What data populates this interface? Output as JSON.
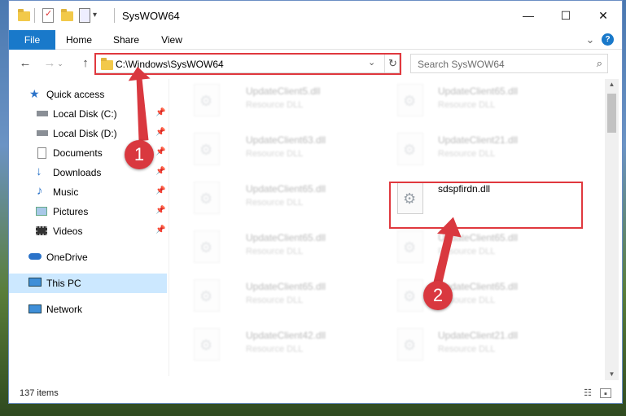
{
  "window": {
    "title": "SysWOW64",
    "controls": {
      "minimize": "—",
      "maximize": "☐",
      "close": "✕"
    }
  },
  "quick_access_toolbar": {
    "dropdown": "▾"
  },
  "ribbon": {
    "tabs": [
      "File",
      "Home",
      "Share",
      "View"
    ],
    "collapse": "⌄",
    "help": "?"
  },
  "nav": {
    "back": "←",
    "forward": "→",
    "up": "↑",
    "address": "C:\\Windows\\SysWOW64",
    "address_dropdown": "⌄",
    "refresh": "↻",
    "search_placeholder": "Search SysWOW64",
    "search_icon": "⌕"
  },
  "sidebar": {
    "quick_access": "Quick access",
    "items": [
      {
        "label": "Local Disk (C:)",
        "icon": "drive-icon",
        "pinned": true
      },
      {
        "label": "Local Disk (D:)",
        "icon": "drive-icon",
        "pinned": true
      },
      {
        "label": "Documents",
        "icon": "documents-icon",
        "pinned": true
      },
      {
        "label": "Downloads",
        "icon": "downloads-icon",
        "pinned": true
      },
      {
        "label": "Music",
        "icon": "music-icon",
        "pinned": true
      },
      {
        "label": "Pictures",
        "icon": "pictures-icon",
        "pinned": true
      },
      {
        "label": "Videos",
        "icon": "videos-icon",
        "pinned": true
      }
    ],
    "onedrive": "OneDrive",
    "this_pc": "This PC",
    "network": "Network",
    "pin_glyph": "📌"
  },
  "files": {
    "left": [
      {
        "name": "UpdateClient5.dll",
        "type": "Resource DLL"
      },
      {
        "name": "UpdateClient63.dll",
        "type": "Resource DLL"
      },
      {
        "name": "UpdateClient65.dll",
        "type": "Resource DLL"
      },
      {
        "name": "UpdateClient65.dll",
        "type": "Resource DLL"
      },
      {
        "name": "UpdateClient65.dll",
        "type": "Resource DLL"
      },
      {
        "name": "UpdateClient42.dll",
        "type": "Resource DLL"
      }
    ],
    "right": [
      {
        "name": "UpdateClient65.dll",
        "type": "Resource DLL"
      },
      {
        "name": "UpdateClient21.dll",
        "type": "Resource DLL"
      },
      {
        "name": "sdspfirdn.dll",
        "type": ""
      },
      {
        "name": "UpdateClient65.dll",
        "type": "Resource DLL"
      },
      {
        "name": "UpdateClient65.dll",
        "type": "Resource DLL"
      },
      {
        "name": "UpdateClient21.dll",
        "type": "Resource DLL"
      }
    ]
  },
  "status": {
    "count": "137 items"
  },
  "annotations": {
    "one": "1",
    "two": "2"
  },
  "colors": {
    "accent": "#1979ca",
    "highlight": "#e0383e",
    "selected": "#cce8ff"
  }
}
